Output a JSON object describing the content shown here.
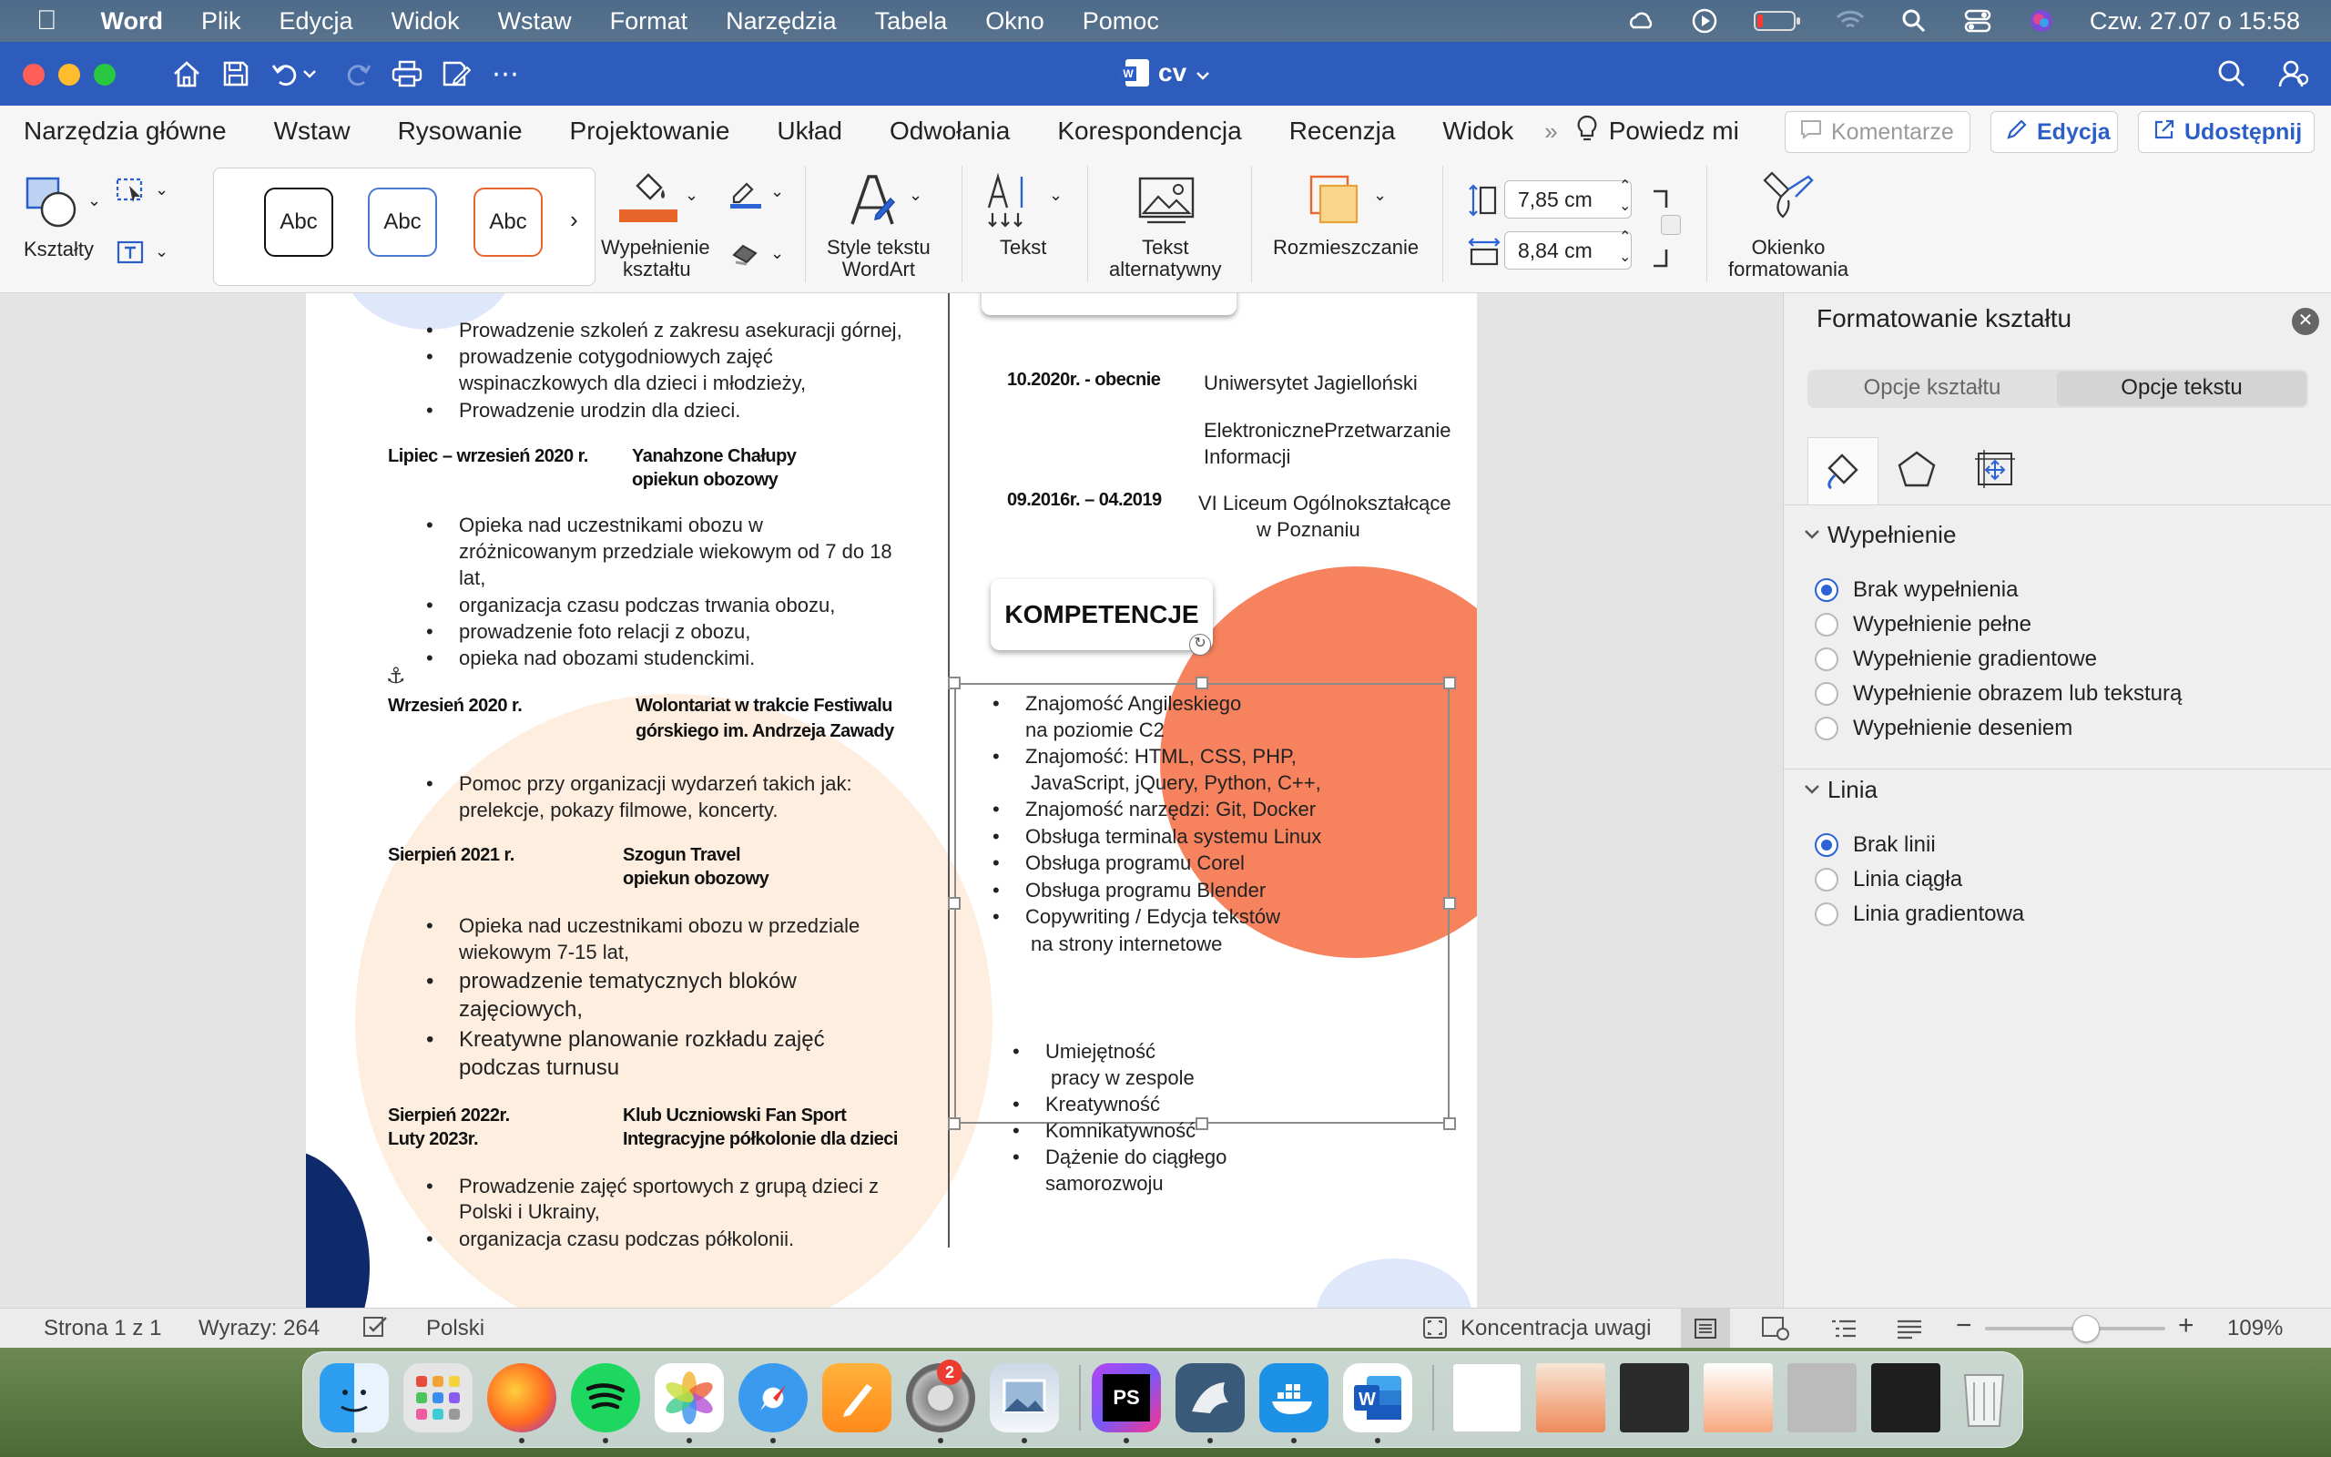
{
  "menubar": {
    "app": "Word",
    "items": [
      "Plik",
      "Edycja",
      "Widok",
      "Wstaw",
      "Format",
      "Narzędzia",
      "Tabela",
      "Okno",
      "Pomoc"
    ],
    "datetime": "Czw. 27.07 o  15:58"
  },
  "titlebar": {
    "doc_title": "cv"
  },
  "ribbon_tabs": [
    "Narzędzia główne",
    "Wstaw",
    "Rysowanie",
    "Projektowanie",
    "Układ",
    "Odwołania",
    "Korespondencja",
    "Recenzja",
    "Widok"
  ],
  "tell_me": "Powiedz mi",
  "ribbon_buttons": {
    "comments": "Komentarze",
    "editing": "Edycja",
    "share": "Udostępnij"
  },
  "ribbon": {
    "shapes": "Kształty",
    "style_sample": "Abc",
    "fill": "Wypełnienie kształtu",
    "fill_l1": "Wypełnienie",
    "fill_l2": "kształtu",
    "wordart_l1": "Style tekstu",
    "wordart_l2": "WordArt",
    "text": "Tekst",
    "alt_l1": "Tekst",
    "alt_l2": "alternatywny",
    "arrange": "Rozmieszczanie",
    "height": "7,85  cm",
    "width": "8,84  cm",
    "format_l1": "Okienko",
    "format_l2": "formatowania"
  },
  "document": {
    "left": {
      "b1": [
        "Prowadzenie szkoleń z zakresu asekuracji górnej,",
        "prowadzenie cotygodniowych zajęć",
        "wspinaczkowych dla dzieci i młodzieży,",
        "Prowadzenie urodzin dla dzieci."
      ],
      "e1_date": "Lipiec – wrzesień 2020 r.",
      "e1_org": "Yanahzone Chałupy",
      "e1_role": "opiekun obozowy",
      "b2": [
        "Opieka nad uczestnikami obozu w",
        "zróżnicowanym przedziale wiekowym od 7 do 18",
        "lat,",
        "organizacja czasu podczas trwania obozu,",
        "prowadzenie foto relacji z obozu,",
        "opieka nad obozami studenckimi."
      ],
      "e2_date": "Wrzesień 2020 r.",
      "e2_org": "Wolontariat w trakcie Festiwalu",
      "e2_org2": "górskiego im. Andrzeja Zawady",
      "b3": [
        "Pomoc przy organizacji wydarzeń takich jak:",
        "prelekcje, pokazy filmowe, koncerty."
      ],
      "e3_date": "Sierpień 2021 r.",
      "e3_org": "Szogun Travel",
      "e3_role": "opiekun obozowy",
      "b4": [
        "Opieka nad uczestnikami obozu w przedziale",
        "wiekowym 7-15 lat,",
        "prowadzenie tematycznych bloków",
        "zajęciowych,",
        "Kreatywne planowanie rozkładu zajęć",
        "podczas turnusu"
      ],
      "e4_date1": "Sierpień 2022r.",
      "e4_date2": "Luty 2023r.",
      "e4_org": "Klub Uczniowski Fan Sport",
      "e4_org2": "Integracyjne półkolonie dla dzieci",
      "b5": [
        "Prowadzenie zajęć sportowych z grupą dzieci z",
        "Polski i Ukrainy,",
        "organizacja czasu podczas półkolonii."
      ]
    },
    "right": {
      "edu1_date": "10.2020r. - obecnie",
      "edu1_school": "Uniwersytet Jagielloński",
      "edu1_field1": "ElektroniczneP rzetwarzanie",
      "edu1_field1_display": "ElektronicznePrzetwarzanie",
      "edu1_field2": "Informacji",
      "edu2_date": "09.2016r. – 04.2019",
      "edu2_school": "VI Liceum Ogólnokształcące",
      "edu2_city": "w Poznaniu",
      "section_title": "KOMPETENCJE",
      "skills": [
        "Znajomość Angileskiego",
        "na poziomie C2",
        "Znajomość: HTML, CSS, PHP,",
        "JavaScript, jQuery, Python, C++,",
        "Znajomość narzędzi: Git, Docker",
        "Obsługa terminala systemu Linux",
        "Obsługa programu Corel",
        "Obsługa programu Blender",
        "Copywriting / Edycja tekstów",
        "na strony internetowe"
      ],
      "soft": [
        "Umiejętność",
        "pracy w zespole",
        "Kreatywność",
        "Komnikatywność",
        "Dążenie do ciągłego",
        "samorozwoju"
      ]
    }
  },
  "pane": {
    "title": "Formatowanie kształtu",
    "tab_shape": "Opcje kształtu",
    "tab_text": "Opcje tekstu",
    "fill_section": "Wypełnienie",
    "fill_options": [
      "Brak wypełnienia",
      "Wypełnienie pełne",
      "Wypełnienie gradientowe",
      "Wypełnienie obrazem lub teksturą",
      "Wypełnienie deseniem"
    ],
    "line_section": "Linia",
    "line_options": [
      "Brak linii",
      "Linia ciągła",
      "Linia gradientowa"
    ]
  },
  "status": {
    "page": "Strona 1 z 1",
    "words": "Wyrazy: 264",
    "language": "Polski",
    "focus": "Koncentracja uwagi",
    "zoom": "109%",
    "zoom_level": 0.56
  },
  "dock": {
    "settings_badge": "2"
  },
  "colors": {
    "titlebar": "#2d5cbd",
    "accent": "#2b62d4",
    "fill_orange": "#e8652c",
    "circle_coral": "#f7835e",
    "circle_peach": "#fdeee0",
    "circle_navy": "#0e2a6b"
  }
}
